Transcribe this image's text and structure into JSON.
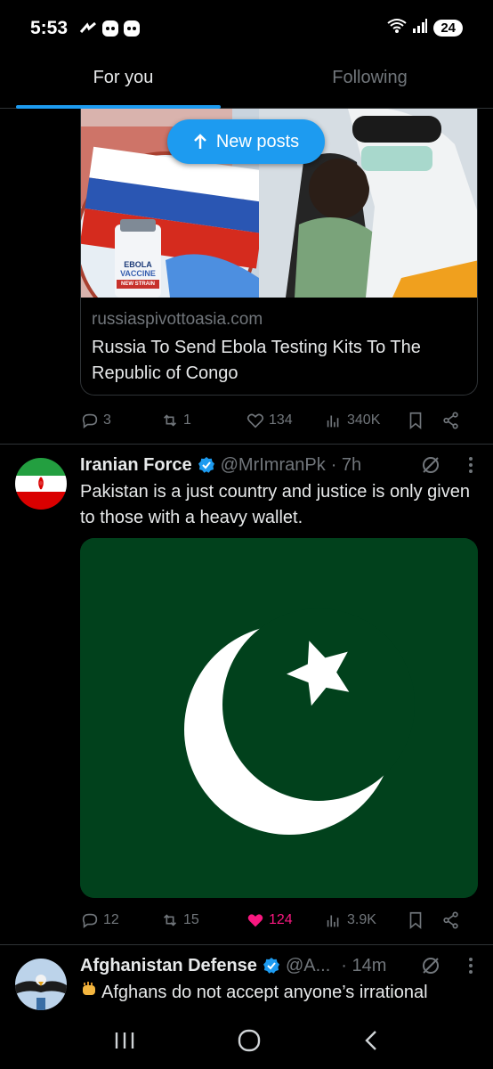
{
  "status_bar": {
    "time": "5:53",
    "battery": "24"
  },
  "tabs": [
    {
      "label": "For you",
      "active": true
    },
    {
      "label": "Following",
      "active": false
    }
  ],
  "new_posts": {
    "label": "New posts"
  },
  "link_card": {
    "image_text_1": "EBOLA",
    "image_text_2": "VACCINE",
    "image_text_3": "NEW STRAIN",
    "domain": "russiaspivottoasia.com",
    "title": "Russia To Send Ebola Testing Kits To The Republic of Congo"
  },
  "post1_actions": {
    "replies": "3",
    "reposts": "1",
    "likes": "134",
    "views": "340K"
  },
  "post2": {
    "name": "Iranian Force",
    "handle": "@MrImranPk",
    "time": "· 7h",
    "text": "Pakistan is a just country and justice is only given to those with a heavy wallet.",
    "actions": {
      "replies": "12",
      "reposts": "15",
      "likes": "124",
      "views": "3.9K"
    }
  },
  "post3": {
    "name": "Afghanistan Defense",
    "handle": "@A...",
    "time": "· 14m",
    "text": "Afghans do not accept anyone’s irrational"
  },
  "colors": {
    "accent": "#1d9bf0",
    "like": "#f91880",
    "background": "#000000",
    "muted": "#71767b"
  }
}
